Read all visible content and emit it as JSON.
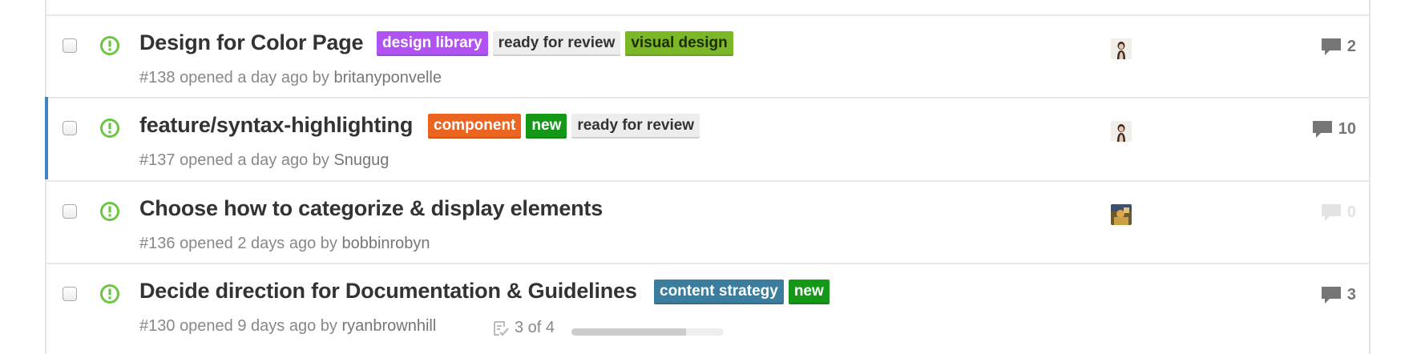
{
  "colors": {
    "open_icon": "#6cc644",
    "selection_bar": "#4183c4"
  },
  "issues": [
    {
      "title": "Design for Color Page",
      "number": "#138",
      "opened_text": "opened a day ago by",
      "author": "britanyponvelle",
      "state_icon": "issue-opened-icon",
      "labels": [
        {
          "text": "design library",
          "bg": "#b153f3",
          "fg": "#ffffff"
        },
        {
          "text": "ready for review",
          "bg": "#ededed",
          "fg": "#333333"
        },
        {
          "text": "visual design",
          "bg": "#7cb728",
          "fg": "#1d2d07"
        }
      ],
      "assignee_avatar": "avatar-icon",
      "comment_icon": "comment-icon",
      "comment_count": "2"
    },
    {
      "title": "feature/syntax-highlighting",
      "number": "#137",
      "opened_text": "opened a day ago by",
      "author": "Snugug",
      "state_icon": "issue-opened-icon",
      "selected": true,
      "labels": [
        {
          "text": "component",
          "bg": "#eb6420",
          "fg": "#ffffff"
        },
        {
          "text": "new",
          "bg": "#159818",
          "fg": "#ffffff"
        },
        {
          "text": "ready for review",
          "bg": "#ededed",
          "fg": "#333333"
        }
      ],
      "assignee_avatar": "avatar-icon",
      "comment_icon": "comment-icon",
      "comment_count": "10"
    },
    {
      "title": "Choose how to categorize & display elements",
      "number": "#136",
      "opened_text": "opened 2 days ago by",
      "author": "bobbinrobyn",
      "state_icon": "issue-opened-icon",
      "labels": [],
      "assignee_avatar": "avatar-icon",
      "comment_icon": "comment-icon",
      "comment_count": "0"
    },
    {
      "title": "Decide direction for Documentation & Guidelines",
      "number": "#130",
      "opened_text": "opened 9 days ago by",
      "author": "ryanbrownhill",
      "state_icon": "issue-opened-icon",
      "labels": [
        {
          "text": "content strategy",
          "bg": "#3b7d9e",
          "fg": "#ffffff"
        },
        {
          "text": "new",
          "bg": "#159818",
          "fg": "#ffffff"
        }
      ],
      "task_icon": "checklist-icon",
      "task_progress_text": "3 of 4",
      "task_progress_fraction": 0.75,
      "comment_icon": "comment-icon",
      "comment_count": "3"
    }
  ]
}
